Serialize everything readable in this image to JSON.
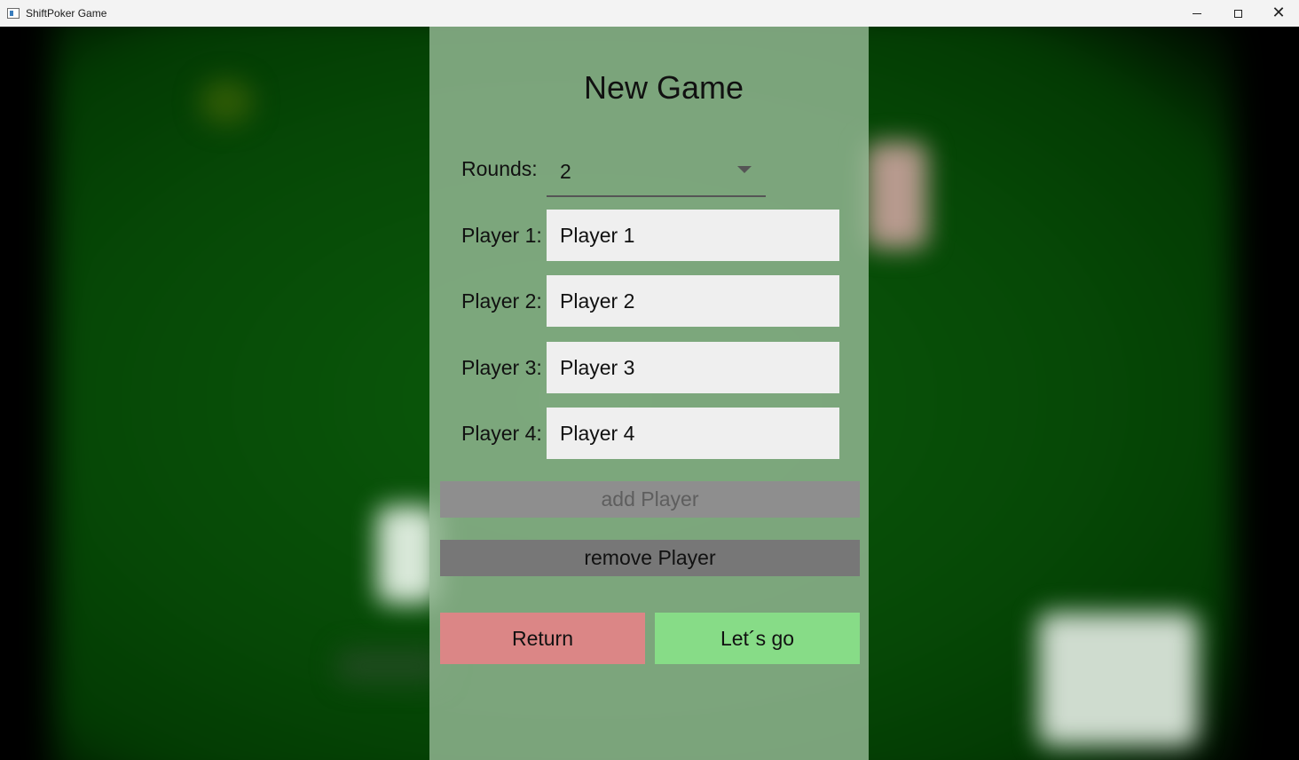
{
  "window": {
    "title": "ShiftPoker Game",
    "controls": {
      "minimize": "minimize-icon",
      "maximize": "maximize-icon",
      "close": "close-icon"
    }
  },
  "dialog": {
    "title": "New Game",
    "rounds": {
      "label": "Rounds:",
      "value": "2"
    },
    "players": [
      {
        "label": "Player 1:",
        "value": "Player 1"
      },
      {
        "label": "Player 2:",
        "value": "Player 2"
      },
      {
        "label": "Player 3:",
        "value": "Player 3"
      },
      {
        "label": "Player 4:",
        "value": "Player 4"
      }
    ],
    "add_player_label": "add Player",
    "remove_player_label": "remove Player",
    "return_label": "Return",
    "go_label": "Let´s go"
  },
  "colors": {
    "return_button": "#db8686",
    "go_button": "#87dc87",
    "add_button_disabled": "#8e8e8e",
    "remove_button": "#777777",
    "table_felt": "#064806"
  }
}
